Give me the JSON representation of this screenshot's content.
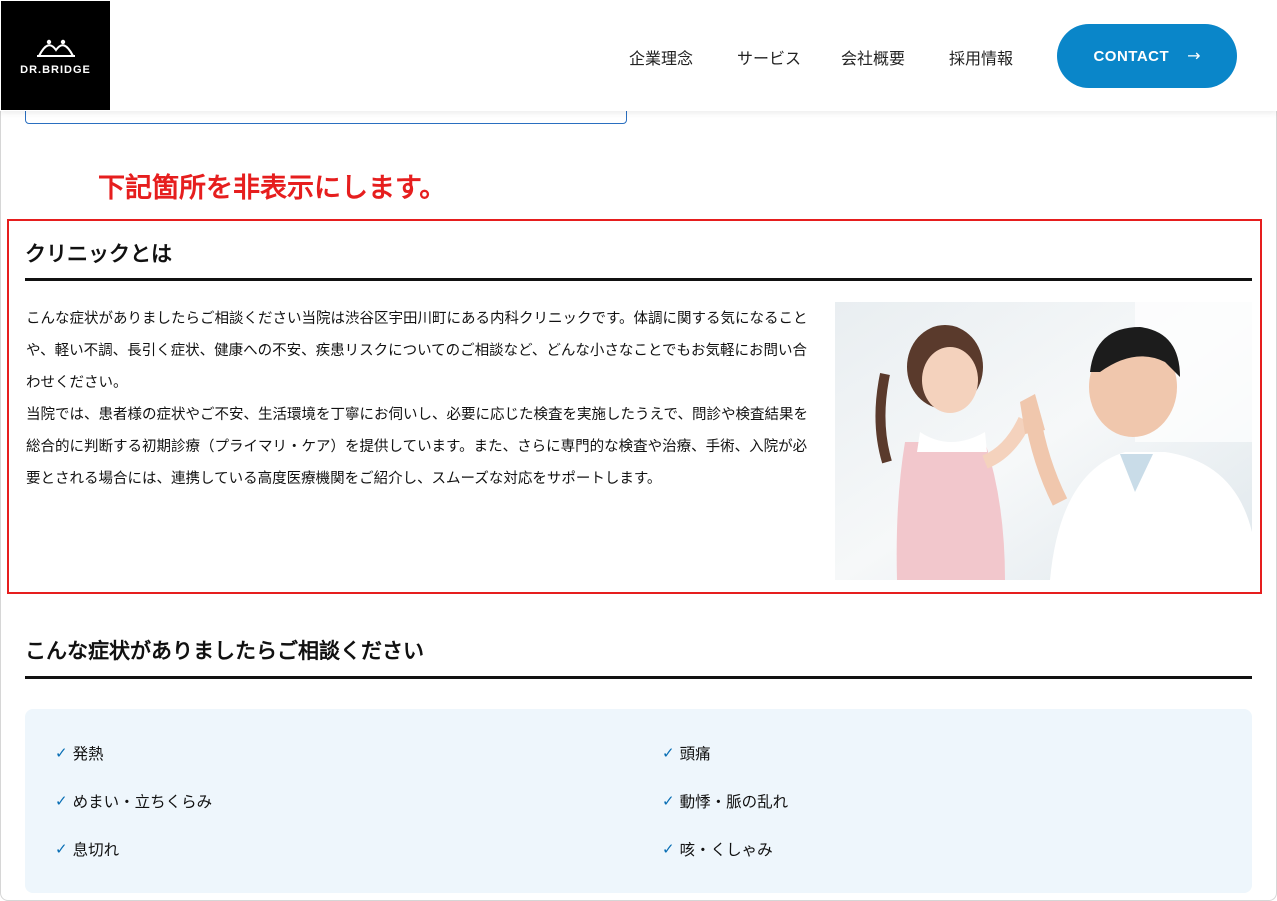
{
  "header": {
    "logo_text": "DR.BRIDGE",
    "nav": [
      "企業理念",
      "サービス",
      "会社概要",
      "採用情報"
    ],
    "contact_label": "CONTACT",
    "contact_arrow": "→"
  },
  "annotation": "下記箇所を非表示にします。",
  "clinic": {
    "title": "クリニックとは",
    "paragraphs": [
      "こんな症状がありましたらご相談ください当院は渋谷区宇田川町にある内科クリニックです。体調に関する気になることや、軽い不調、長引く症状、健康への不安、疾患リスクについてのご相談など、どんな小さなことでもお気軽にお問い合わせください。",
      "当院では、患者様の症状やご不安、生活環境を丁寧にお伺いし、必要に応じた検査を実施したうえで、問診や検査結果を総合的に判断する初期診療（プライマリ・ケア）を提供しています。また、さらに専門的な検査や治療、手術、入院が必要とされる場合には、連携している高度医療機関をご紹介し、スムーズな対応をサポートします。"
    ]
  },
  "symptoms": {
    "title": "こんな症状がありましたらご相談ください",
    "items": [
      "発熱",
      "頭痛",
      "めまい・立ちくらみ",
      "動悸・脈の乱れ",
      "息切れ",
      "咳・くしゃみ"
    ]
  },
  "colors": {
    "accent": "#0a86c9",
    "annotation_red": "#e61e1e",
    "panel_bg": "#eef6fc"
  },
  "icons": {
    "check": "check-icon",
    "logo": "bridge-logo-icon",
    "arrow": "arrow-right-icon"
  }
}
